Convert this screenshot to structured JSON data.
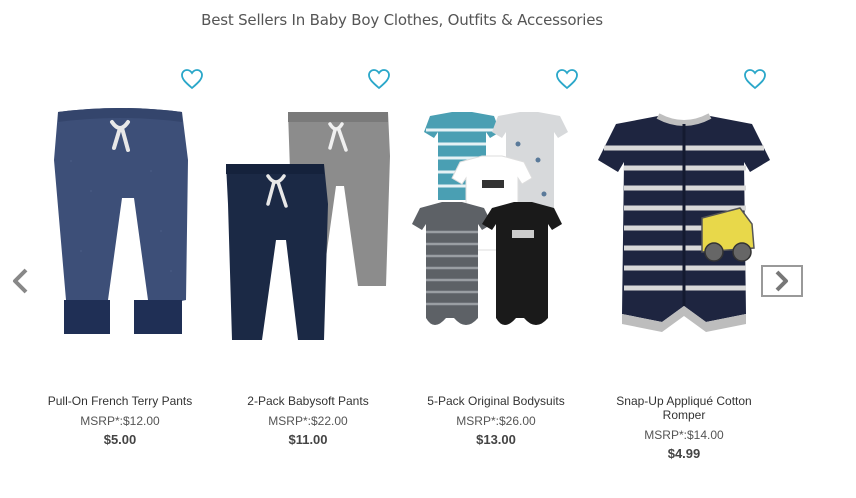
{
  "section_title": "Best Sellers In Baby Boy Clothes, Outfits & Accessories",
  "carousel": {
    "prev_icon": "chevron-left-icon",
    "next_icon": "chevron-right-icon"
  },
  "products": [
    {
      "name": "Pull-On French Terry Pants",
      "msrp": "MSRP*:$12.00",
      "price": "$5.00"
    },
    {
      "name": "2-Pack Babysoft Pants",
      "msrp": "MSRP*:$22.00",
      "price": "$11.00"
    },
    {
      "name": "5-Pack Original Bodysuits",
      "msrp": "MSRP*:$26.00",
      "price": "$13.00"
    },
    {
      "name": "Snap-Up Appliqué Cotton Romper",
      "msrp": "MSRP*:$14.00",
      "price": "$4.99"
    }
  ],
  "colors": {
    "heart_accent": "#2aa7c9",
    "arrow_gray": "#888888"
  }
}
